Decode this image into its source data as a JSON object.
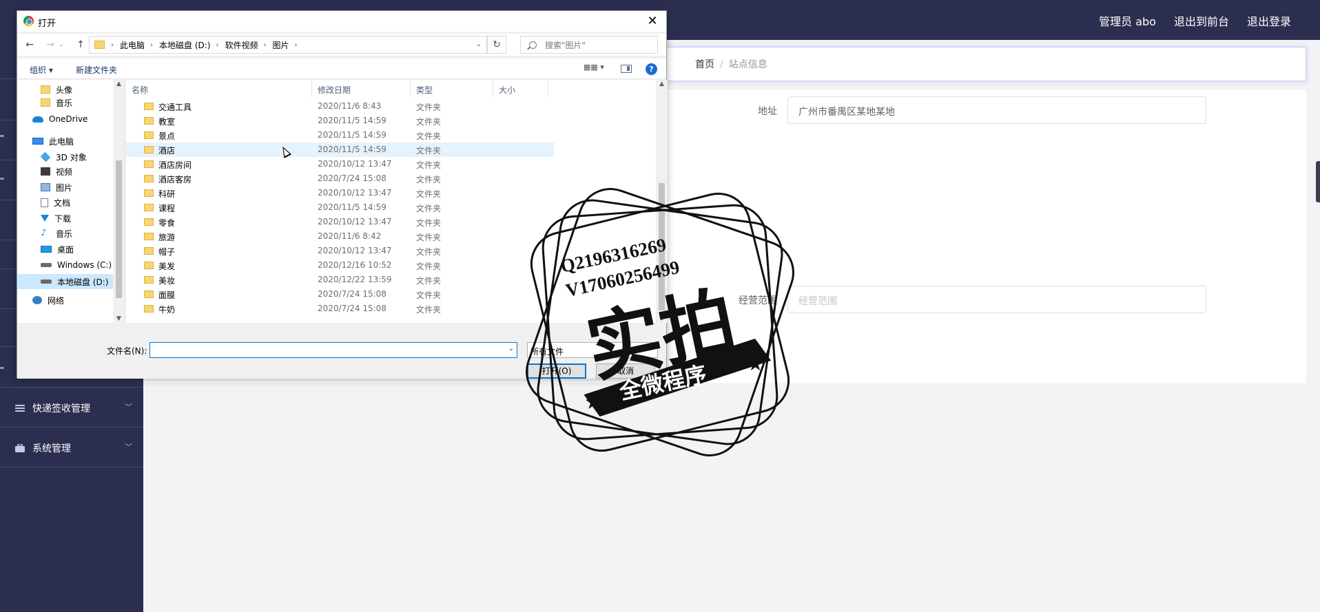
{
  "topbar": {
    "links": [
      "管理员 abo",
      "退出到前台",
      "退出登录"
    ]
  },
  "sidebar": {
    "menus": [
      {
        "label": "快递签收管理",
        "icon": "list-icon"
      },
      {
        "label": "系统管理",
        "icon": "briefcase-icon"
      }
    ]
  },
  "breadcrumb": {
    "home": "首页",
    "separator": "/",
    "current": "站点信息"
  },
  "form": {
    "address_label": "地址",
    "address_value": "广州市番禺区某地某地",
    "scope_label": "经营范围",
    "scope_placeholder": "经营范围"
  },
  "dialog": {
    "title": "打开",
    "path": [
      "此电脑",
      "本地磁盘 (D:)",
      "软件视频",
      "图片"
    ],
    "search_placeholder": "搜索\"图片\"",
    "toolbar": {
      "organize": "组织 ▾",
      "new_folder": "新建文件夹",
      "help": "?"
    },
    "nav_items": [
      {
        "label": "头像",
        "icon": "folder-icon",
        "indent": 2
      },
      {
        "label": "音乐",
        "icon": "folder-icon",
        "indent": 2
      },
      {
        "label": "OneDrive",
        "icon": "cloud-icon",
        "indent": 1
      },
      {
        "label": "此电脑",
        "icon": "computer-icon",
        "indent": 1
      },
      {
        "label": "3D 对象",
        "icon": "cube-icon",
        "indent": 2
      },
      {
        "label": "视频",
        "icon": "video-icon",
        "indent": 2
      },
      {
        "label": "图片",
        "icon": "picture-icon",
        "indent": 2
      },
      {
        "label": "文档",
        "icon": "document-icon",
        "indent": 2
      },
      {
        "label": "下载",
        "icon": "download-icon",
        "indent": 2
      },
      {
        "label": "音乐",
        "icon": "music-icon",
        "indent": 2
      },
      {
        "label": "桌面",
        "icon": "desktop-icon",
        "indent": 2
      },
      {
        "label": "Windows (C:)",
        "icon": "drive-icon",
        "indent": 2
      },
      {
        "label": "本地磁盘 (D:)",
        "icon": "drive-icon",
        "indent": 2,
        "selected": true
      },
      {
        "label": "网络",
        "icon": "network-icon",
        "indent": 1
      }
    ],
    "columns": [
      "名称",
      "修改日期",
      "类型",
      "大小"
    ],
    "files": [
      {
        "name": "交通工具",
        "date": "2020/11/6 8:43",
        "type": "文件夹"
      },
      {
        "name": "教室",
        "date": "2020/11/5 14:59",
        "type": "文件夹"
      },
      {
        "name": "景点",
        "date": "2020/11/5 14:59",
        "type": "文件夹"
      },
      {
        "name": "酒店",
        "date": "2020/11/5 14:59",
        "type": "文件夹",
        "hover": true
      },
      {
        "name": "酒店房间",
        "date": "2020/10/12 13:47",
        "type": "文件夹"
      },
      {
        "name": "酒店客房",
        "date": "2020/7/24 15:08",
        "type": "文件夹"
      },
      {
        "name": "科研",
        "date": "2020/10/12 13:47",
        "type": "文件夹"
      },
      {
        "name": "课程",
        "date": "2020/11/5 14:59",
        "type": "文件夹"
      },
      {
        "name": "零食",
        "date": "2020/10/12 13:47",
        "type": "文件夹"
      },
      {
        "name": "旅游",
        "date": "2020/11/6 8:42",
        "type": "文件夹"
      },
      {
        "name": "帽子",
        "date": "2020/10/12 13:47",
        "type": "文件夹"
      },
      {
        "name": "美发",
        "date": "2020/12/16 10:52",
        "type": "文件夹"
      },
      {
        "name": "美妆",
        "date": "2020/12/22 13:59",
        "type": "文件夹"
      },
      {
        "name": "面膜",
        "date": "2020/7/24 15:08",
        "type": "文件夹"
      },
      {
        "name": "牛奶",
        "date": "2020/7/24 15:08",
        "type": "文件夹"
      }
    ],
    "filename_label": "文件名(N):",
    "filename_value": "",
    "filetype": "所有文件",
    "open_button": "打开(O)",
    "cancel_button": "取消"
  },
  "watermark": {
    "line1": "Q2196316269",
    "line2": "V17060256499",
    "big": "实拍",
    "ribbon": "全微程序"
  }
}
